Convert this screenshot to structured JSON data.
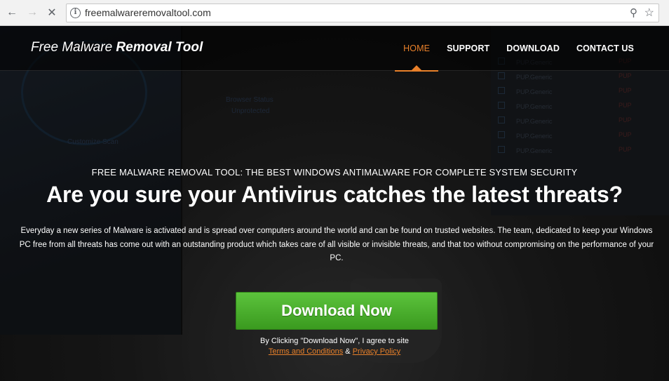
{
  "browser": {
    "url": "freemalwareremovaltool.com"
  },
  "site": {
    "logo_light": "Free Malware ",
    "logo_bold": "Removal Tool",
    "menu": [
      {
        "label": "HOME",
        "active": true
      },
      {
        "label": "SUPPORT"
      },
      {
        "label": "DOWNLOAD"
      },
      {
        "label": "CONTACT US"
      }
    ]
  },
  "hero": {
    "subtitle": "FREE MALWARE REMOVAL TOOL: THE BEST WINDOWS ANTIMALWARE FOR COMPLETE SYSTEM SECURITY",
    "headline": "Are you sure your Antivirus catches the latest threats?",
    "description": "Everyday a new series of Malware is activated and is spread over computers around the world and can be found on trusted websites. The team, dedicated to keep your Windows PC free from all threats has come out with an outstanding product which takes care of all visible or invisible threats, and that too without compromising on the performance of your PC.",
    "cta_label": "Download Now",
    "agree_prefix": "By Clicking \"Download Now\", I agree to site",
    "terms_label": "Terms and Conditions",
    "amp": "&",
    "privacy_label": "Privacy Policy"
  },
  "background_text": {
    "scan_label": "Customize Scan",
    "browser_status": "Browser Status",
    "unprotected": "Unprotected",
    "pup_generic": "PUP.Generic",
    "pup": "PUP"
  },
  "colors": {
    "accent": "#e8802a",
    "cta_green": "#4cb02e"
  }
}
